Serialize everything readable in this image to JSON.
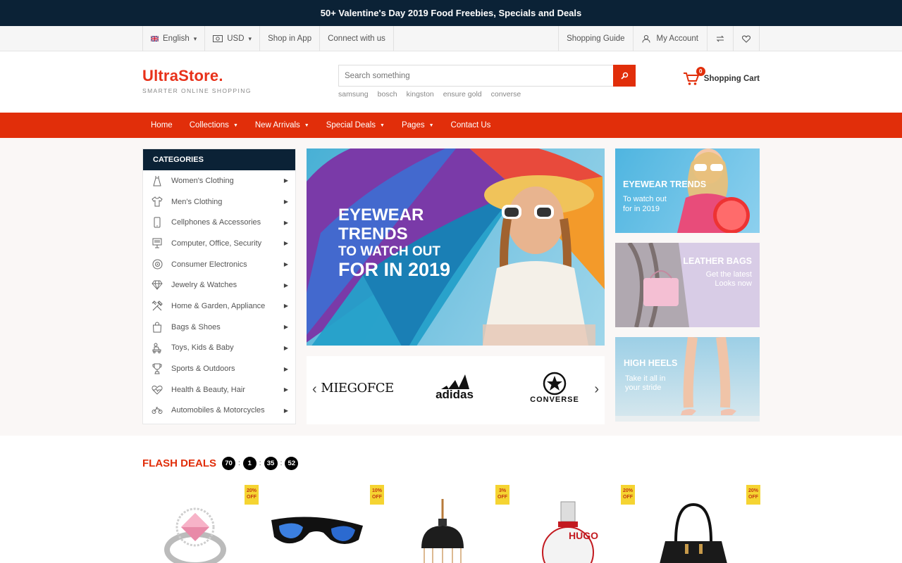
{
  "promo": "50+ Valentine's Day 2019 Food Freebies, Specials and Deals",
  "topbar": {
    "language": "English",
    "currency": "USD",
    "shop_in_app": "Shop in App",
    "connect": "Connect with us",
    "shopping_guide": "Shopping Guide",
    "my_account": "My Account"
  },
  "header": {
    "logo": "UltraStore.",
    "tagline": "SMARTER ONLINE SHOPPING",
    "search_placeholder": "Search something",
    "tags": [
      "samsung",
      "bosch",
      "kingston",
      "ensure gold",
      "converse"
    ],
    "cart_count": "0",
    "cart_label": "Shopping Cart"
  },
  "nav": [
    "Home",
    "Collections",
    "New Arrivals",
    "Special Deals",
    "Pages",
    "Contact Us"
  ],
  "categories": {
    "title": "CATEGORIES",
    "items": [
      {
        "label": "Women's Clothing",
        "icon": "dress-icon"
      },
      {
        "label": "Men's Clothing",
        "icon": "shirt-icon"
      },
      {
        "label": "Cellphones & Accessories",
        "icon": "phone-icon"
      },
      {
        "label": "Computer, Office, Security",
        "icon": "computer-icon"
      },
      {
        "label": "Consumer Electronics",
        "icon": "electronics-icon"
      },
      {
        "label": "Jewelry & Watches",
        "icon": "diamond-icon"
      },
      {
        "label": "Home & Garden, Appliance",
        "icon": "tools-icon"
      },
      {
        "label": "Bags & Shoes",
        "icon": "bag-icon"
      },
      {
        "label": "Toys, Kids & Baby",
        "icon": "toy-icon"
      },
      {
        "label": "Sports & Outdoors",
        "icon": "trophy-icon"
      },
      {
        "label": "Health & Beauty, Hair",
        "icon": "heart-pulse-icon"
      },
      {
        "label": "Automobiles & Motorcycles",
        "icon": "motorcycle-icon"
      }
    ]
  },
  "banner": {
    "line1": "EYEWEAR",
    "line2": "TRENDS",
    "line3": "TO WATCH OUT",
    "line4": "FOR IN 2019"
  },
  "brands": [
    "MIEGOFCE",
    "adidas",
    "CONVERSE"
  ],
  "side_ads": [
    {
      "title": "EYEWEAR TRENDS",
      "sub1": "To watch out",
      "sub2": "for in 2019"
    },
    {
      "title": "LEATHER BAGS",
      "sub1": "Get the latest",
      "sub2": "Looks now"
    },
    {
      "title": "HIGH HEELS",
      "sub1": "Take it all in",
      "sub2": "your stride"
    }
  ],
  "flash": {
    "title": "FLASH DEALS",
    "timer": [
      "70",
      "1",
      "35",
      "52"
    ]
  },
  "products": [
    {
      "discount": "20%",
      "off": "OFF",
      "image": "ring-icon"
    },
    {
      "discount": "10%",
      "off": "OFF",
      "image": "sunglasses-icon"
    },
    {
      "discount": "3%",
      "off": "OFF",
      "image": "lamp-icon"
    },
    {
      "discount": "20%",
      "off": "OFF",
      "image": "perfume-icon",
      "brand": "HUGO"
    },
    {
      "discount": "20%",
      "off": "OFF",
      "image": "handbag-icon"
    }
  ],
  "colors": {
    "accent": "#e12e0a",
    "dark": "#0b2236",
    "badge": "#f5d432"
  }
}
